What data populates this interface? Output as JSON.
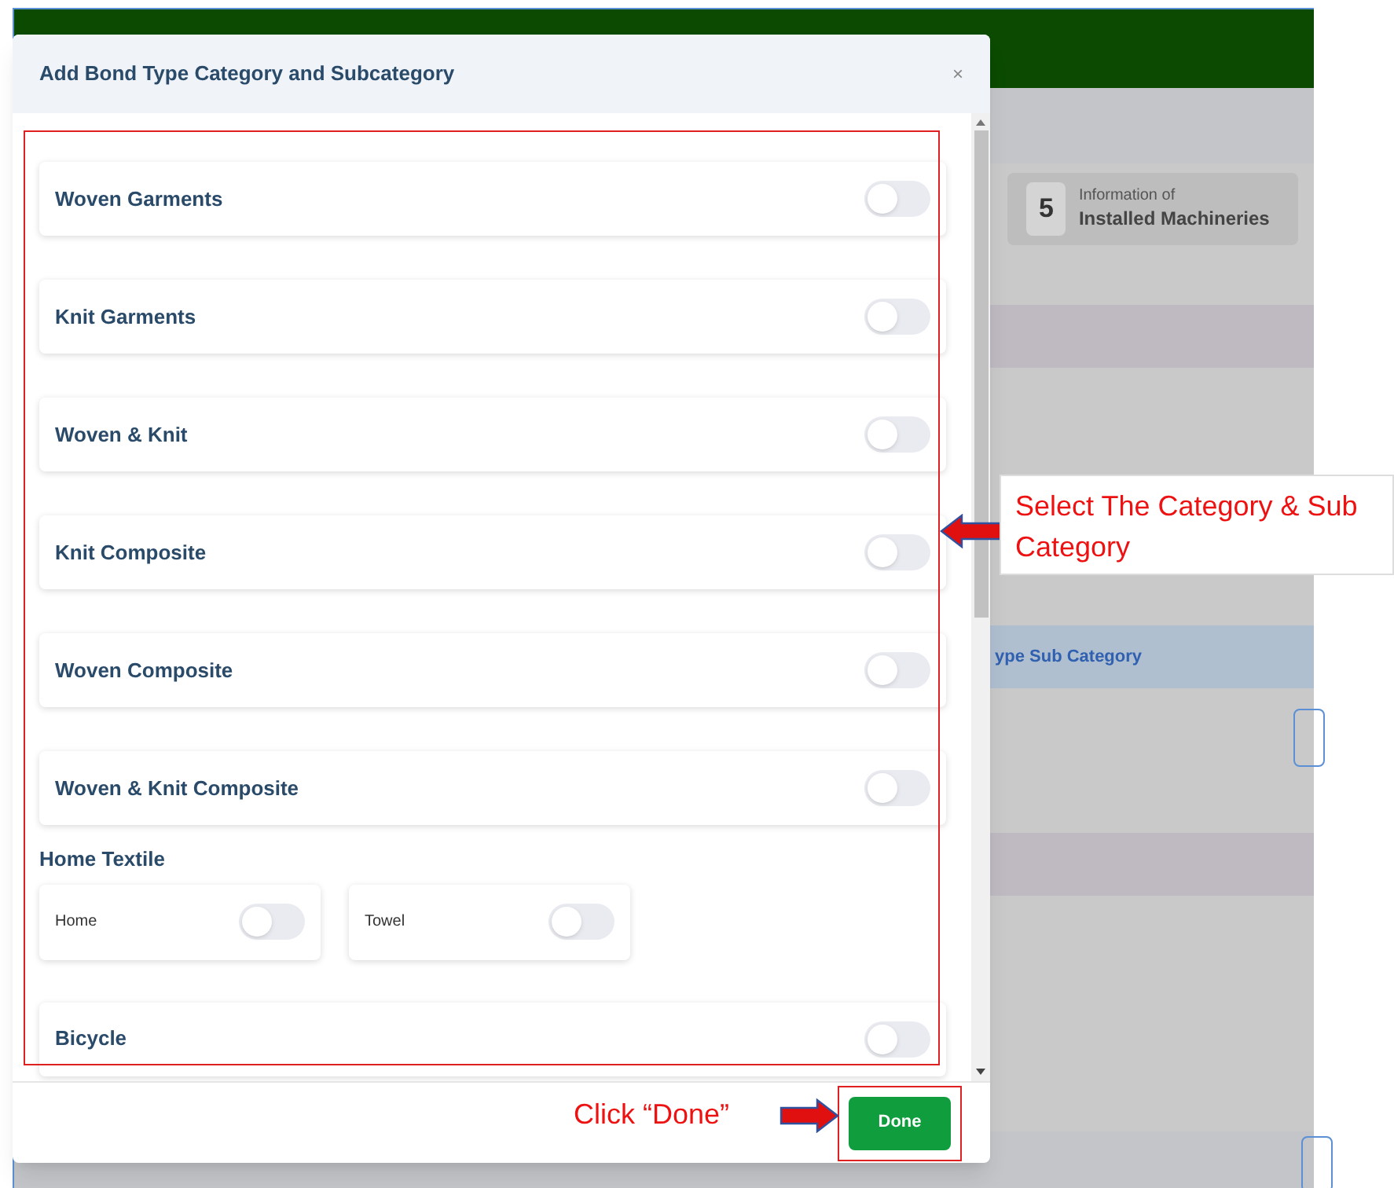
{
  "background_page": {
    "step": {
      "number": "5",
      "caption": "Information of",
      "title": "Installed Machineries"
    },
    "band_text": "ype Sub Category"
  },
  "modal": {
    "title": "Add Bond Type Category and Subcategory",
    "close": "×",
    "categories": [
      {
        "kind": "toggle",
        "label": "Woven Garments",
        "on": false
      },
      {
        "kind": "toggle",
        "label": "Knit Garments",
        "on": false
      },
      {
        "kind": "toggle",
        "label": "Woven & Knit",
        "on": false
      },
      {
        "kind": "toggle",
        "label": "Knit Composite",
        "on": false
      },
      {
        "kind": "toggle",
        "label": "Woven Composite",
        "on": false
      },
      {
        "kind": "toggle",
        "label": "Woven & Knit Composite",
        "on": false
      },
      {
        "kind": "group",
        "label": "Home Textile",
        "children": [
          {
            "label": "Home",
            "on": false
          },
          {
            "label": "Towel",
            "on": false
          }
        ]
      },
      {
        "kind": "toggle",
        "label": "Bicycle",
        "on": false
      }
    ],
    "done_button": "Done"
  },
  "annotations": [
    {
      "text": "Select The Category & Sub Category"
    },
    {
      "text": "Click “Done”"
    }
  ]
}
